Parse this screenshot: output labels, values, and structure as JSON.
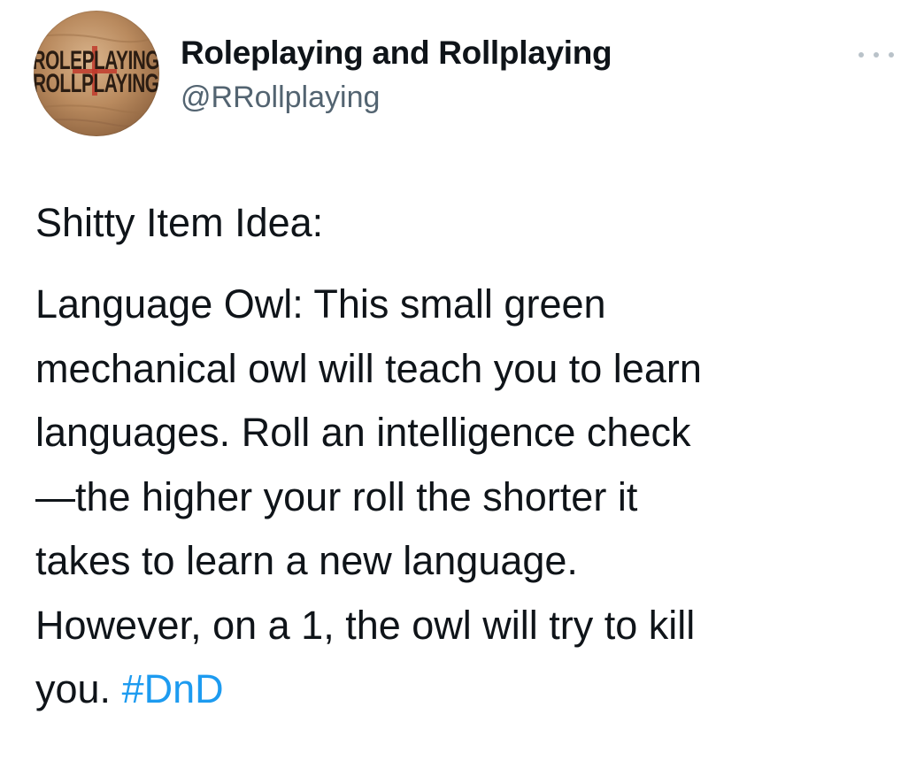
{
  "author": {
    "display_name": "Roleplaying and Rollplaying",
    "handle": "@RRollplaying",
    "avatar_text": [
      "ROLEPLAYING",
      "ROLLPLAYING"
    ]
  },
  "more_icon": "more-horizontal-icon",
  "tweet": {
    "heading": "Shitty Item Idea:",
    "lines": [
      "Language Owl: This small green",
      "mechanical owl will teach you to learn",
      "languages. Roll an intelligence check",
      "—the higher your roll the shorter it",
      "takes to learn a new language.",
      "However, on a 1, the owl will try to kill"
    ],
    "last_line_prefix": "you. ",
    "hashtag": "#DnD"
  },
  "colors": {
    "text": "#0f1419",
    "handle": "#536471",
    "link": "#1d9bf0",
    "avatar_wood": "#b98a5e",
    "avatar_accent": "#c0392b"
  }
}
